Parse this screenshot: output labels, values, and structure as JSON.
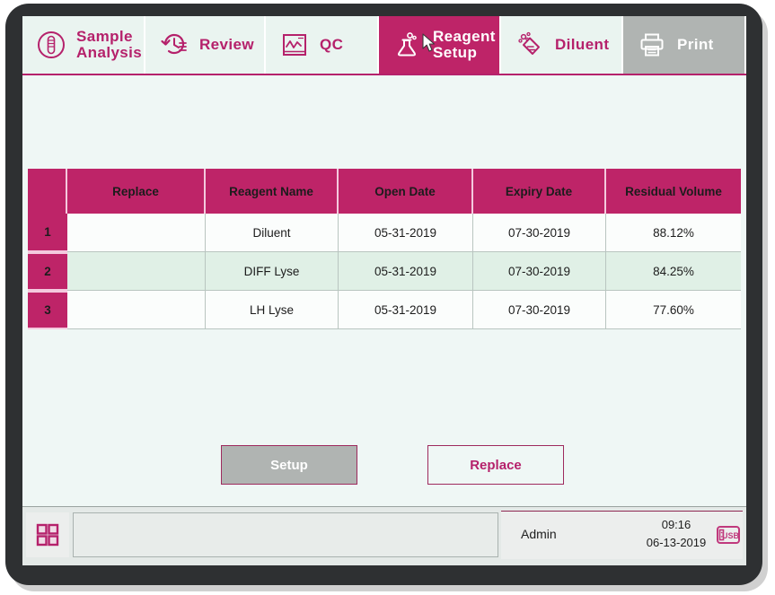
{
  "tabs": [
    {
      "id": "sample",
      "label": "Sample\nAnalysis",
      "icon": "test-tube-icon",
      "state": "normal"
    },
    {
      "id": "review",
      "label": "Review",
      "icon": "history-clock-icon",
      "state": "normal"
    },
    {
      "id": "qc",
      "label": "QC",
      "icon": "chart-frame-icon",
      "state": "normal"
    },
    {
      "id": "reagent",
      "label": "Reagent\nSetup",
      "icon": "flask-icon",
      "state": "active"
    },
    {
      "id": "diluent",
      "label": "Diluent",
      "icon": "diluent-tag-icon",
      "state": "normal"
    },
    {
      "id": "print",
      "label": "Print",
      "icon": "printer-icon",
      "state": "disabled"
    }
  ],
  "table": {
    "headers": [
      "",
      "Replace",
      "Reagent Name",
      "Open Date",
      "Expiry Date",
      "Residual Volume"
    ],
    "rows": [
      {
        "index": "1",
        "replace": "",
        "name": "Diluent",
        "open_date": "05-31-2019",
        "expiry_date": "07-30-2019",
        "residual_volume": "88.12%",
        "selected": false
      },
      {
        "index": "2",
        "replace": "",
        "name": "DIFF Lyse",
        "open_date": "05-31-2019",
        "expiry_date": "07-30-2019",
        "residual_volume": "84.25%",
        "selected": true
      },
      {
        "index": "3",
        "replace": "",
        "name": "LH Lyse",
        "open_date": "05-31-2019",
        "expiry_date": "07-30-2019",
        "residual_volume": "77.60%",
        "selected": false
      }
    ]
  },
  "buttons": {
    "setup": "Setup",
    "replace": "Replace"
  },
  "statusbar": {
    "menu_icon": "grid-menu-icon",
    "message": "",
    "user": "Admin",
    "time": "09:16",
    "date": "06-13-2019",
    "usb_label": "USB"
  },
  "colors": {
    "accent": "#be2468",
    "accent_text": "#b5216b",
    "screen_bg": "#eff7f5",
    "tab_bg": "#eaf4f0",
    "disabled": "#b0b4b2",
    "row_selected": "#e0f0e6",
    "bezel": "#2e3032"
  }
}
